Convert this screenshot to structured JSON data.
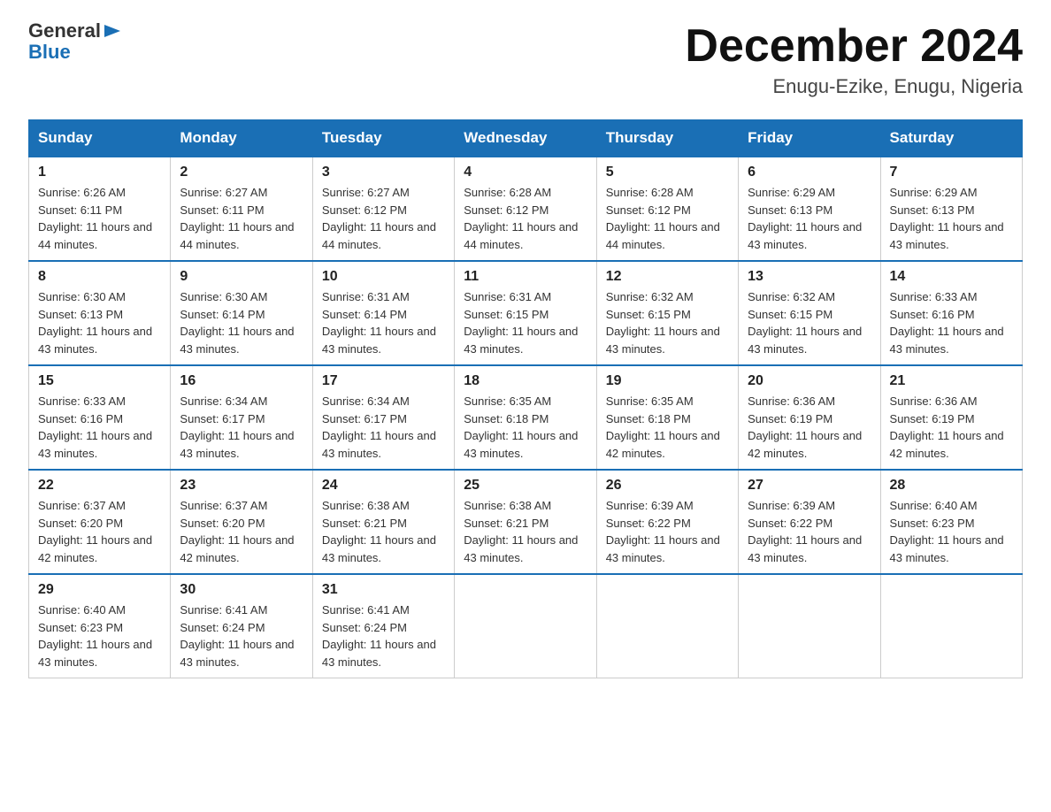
{
  "header": {
    "logo_general": "General",
    "logo_blue": "Blue",
    "month_title": "December 2024",
    "location": "Enugu-Ezike, Enugu, Nigeria"
  },
  "days_of_week": [
    "Sunday",
    "Monday",
    "Tuesday",
    "Wednesday",
    "Thursday",
    "Friday",
    "Saturday"
  ],
  "weeks": [
    [
      {
        "day": "1",
        "sunrise": "6:26 AM",
        "sunset": "6:11 PM",
        "daylight": "11 hours and 44 minutes."
      },
      {
        "day": "2",
        "sunrise": "6:27 AM",
        "sunset": "6:11 PM",
        "daylight": "11 hours and 44 minutes."
      },
      {
        "day": "3",
        "sunrise": "6:27 AM",
        "sunset": "6:12 PM",
        "daylight": "11 hours and 44 minutes."
      },
      {
        "day": "4",
        "sunrise": "6:28 AM",
        "sunset": "6:12 PM",
        "daylight": "11 hours and 44 minutes."
      },
      {
        "day": "5",
        "sunrise": "6:28 AM",
        "sunset": "6:12 PM",
        "daylight": "11 hours and 44 minutes."
      },
      {
        "day": "6",
        "sunrise": "6:29 AM",
        "sunset": "6:13 PM",
        "daylight": "11 hours and 43 minutes."
      },
      {
        "day": "7",
        "sunrise": "6:29 AM",
        "sunset": "6:13 PM",
        "daylight": "11 hours and 43 minutes."
      }
    ],
    [
      {
        "day": "8",
        "sunrise": "6:30 AM",
        "sunset": "6:13 PM",
        "daylight": "11 hours and 43 minutes."
      },
      {
        "day": "9",
        "sunrise": "6:30 AM",
        "sunset": "6:14 PM",
        "daylight": "11 hours and 43 minutes."
      },
      {
        "day": "10",
        "sunrise": "6:31 AM",
        "sunset": "6:14 PM",
        "daylight": "11 hours and 43 minutes."
      },
      {
        "day": "11",
        "sunrise": "6:31 AM",
        "sunset": "6:15 PM",
        "daylight": "11 hours and 43 minutes."
      },
      {
        "day": "12",
        "sunrise": "6:32 AM",
        "sunset": "6:15 PM",
        "daylight": "11 hours and 43 minutes."
      },
      {
        "day": "13",
        "sunrise": "6:32 AM",
        "sunset": "6:15 PM",
        "daylight": "11 hours and 43 minutes."
      },
      {
        "day": "14",
        "sunrise": "6:33 AM",
        "sunset": "6:16 PM",
        "daylight": "11 hours and 43 minutes."
      }
    ],
    [
      {
        "day": "15",
        "sunrise": "6:33 AM",
        "sunset": "6:16 PM",
        "daylight": "11 hours and 43 minutes."
      },
      {
        "day": "16",
        "sunrise": "6:34 AM",
        "sunset": "6:17 PM",
        "daylight": "11 hours and 43 minutes."
      },
      {
        "day": "17",
        "sunrise": "6:34 AM",
        "sunset": "6:17 PM",
        "daylight": "11 hours and 43 minutes."
      },
      {
        "day": "18",
        "sunrise": "6:35 AM",
        "sunset": "6:18 PM",
        "daylight": "11 hours and 43 minutes."
      },
      {
        "day": "19",
        "sunrise": "6:35 AM",
        "sunset": "6:18 PM",
        "daylight": "11 hours and 42 minutes."
      },
      {
        "day": "20",
        "sunrise": "6:36 AM",
        "sunset": "6:19 PM",
        "daylight": "11 hours and 42 minutes."
      },
      {
        "day": "21",
        "sunrise": "6:36 AM",
        "sunset": "6:19 PM",
        "daylight": "11 hours and 42 minutes."
      }
    ],
    [
      {
        "day": "22",
        "sunrise": "6:37 AM",
        "sunset": "6:20 PM",
        "daylight": "11 hours and 42 minutes."
      },
      {
        "day": "23",
        "sunrise": "6:37 AM",
        "sunset": "6:20 PM",
        "daylight": "11 hours and 42 minutes."
      },
      {
        "day": "24",
        "sunrise": "6:38 AM",
        "sunset": "6:21 PM",
        "daylight": "11 hours and 43 minutes."
      },
      {
        "day": "25",
        "sunrise": "6:38 AM",
        "sunset": "6:21 PM",
        "daylight": "11 hours and 43 minutes."
      },
      {
        "day": "26",
        "sunrise": "6:39 AM",
        "sunset": "6:22 PM",
        "daylight": "11 hours and 43 minutes."
      },
      {
        "day": "27",
        "sunrise": "6:39 AM",
        "sunset": "6:22 PM",
        "daylight": "11 hours and 43 minutes."
      },
      {
        "day": "28",
        "sunrise": "6:40 AM",
        "sunset": "6:23 PM",
        "daylight": "11 hours and 43 minutes."
      }
    ],
    [
      {
        "day": "29",
        "sunrise": "6:40 AM",
        "sunset": "6:23 PM",
        "daylight": "11 hours and 43 minutes."
      },
      {
        "day": "30",
        "sunrise": "6:41 AM",
        "sunset": "6:24 PM",
        "daylight": "11 hours and 43 minutes."
      },
      {
        "day": "31",
        "sunrise": "6:41 AM",
        "sunset": "6:24 PM",
        "daylight": "11 hours and 43 minutes."
      },
      null,
      null,
      null,
      null
    ]
  ],
  "labels": {
    "sunrise_prefix": "Sunrise: ",
    "sunset_prefix": "Sunset: ",
    "daylight_prefix": "Daylight: "
  }
}
